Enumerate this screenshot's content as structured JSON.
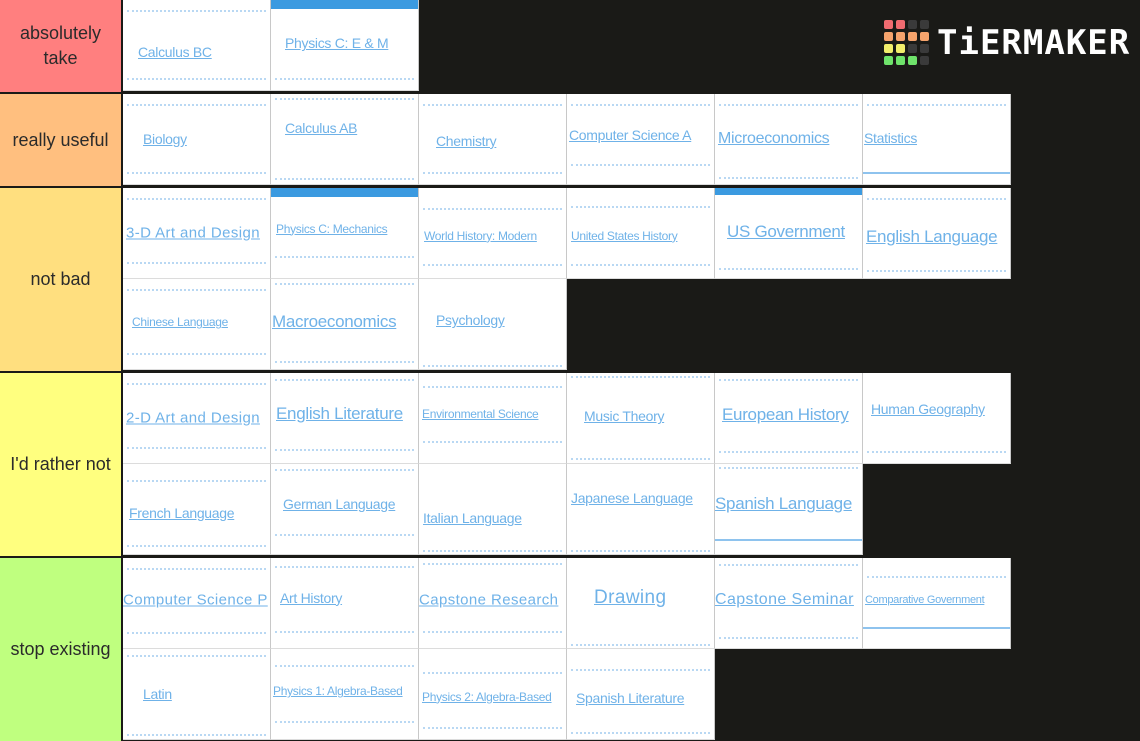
{
  "brand": {
    "name": "TiERMAKER",
    "logo_grid_colors": [
      "#f06b70",
      "#f06b70",
      "#3a3a3a",
      "#3a3a3a",
      "#f5a36c",
      "#f5a36c",
      "#f5a36c",
      "#f5a36c",
      "#f2ee6b",
      "#f2ee6b",
      "#3a3a3a",
      "#3a3a3a",
      "#6fe36b",
      "#6fe36b",
      "#6fe36b",
      "#3a3a3a"
    ]
  },
  "tiers": [
    {
      "label": "absolutely take",
      "color": "#ff7f7f",
      "items": [
        "Calculus BC",
        "Physics C: E & M"
      ]
    },
    {
      "label": "really useful",
      "color": "#ffbf7f",
      "items": [
        "Biology",
        "Calculus AB",
        "Chemistry",
        "Computer Science A",
        "Microeconomics",
        "Statistics"
      ]
    },
    {
      "label": "not bad",
      "color": "#ffdf7f",
      "items": [
        "3-D Art and Design",
        "Physics C: Mechanics",
        "World History: Modern",
        "United States History",
        "US Government",
        "English Language",
        "Chinese Language",
        "Macroeconomics",
        "Psychology"
      ]
    },
    {
      "label": "I'd rather not",
      "color": "#ffff7f",
      "items": [
        "2-D Art and Design",
        "English Literature",
        "Environmental Science",
        "Music Theory",
        "European History",
        "Human Geography",
        "French Language",
        "German Language",
        "Italian Language",
        "Japanese Language",
        "Spanish Language"
      ]
    },
    {
      "label": "stop existing",
      "color": "#bfff7f",
      "items": [
        "Computer Science P",
        "Art History",
        "Capstone Research",
        "Drawing",
        "Capstone Seminar",
        "Comparative Government",
        "Latin",
        "Physics 1: Algebra-Based",
        "Physics 2: Algebra-Based",
        "Spanish Literature"
      ]
    }
  ]
}
